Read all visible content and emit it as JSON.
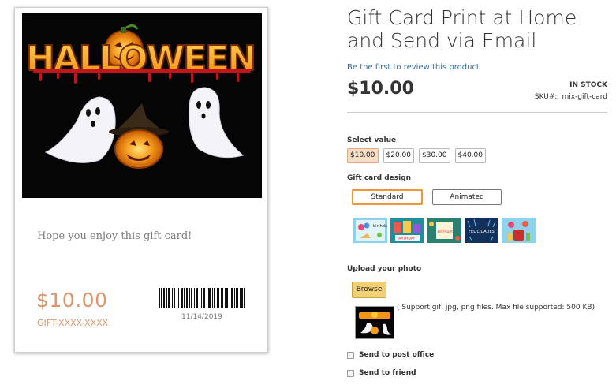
{
  "product": {
    "title": "Gift Card Print at Home and Send via Email",
    "review_link": "Be the first to review this product",
    "price": "$10.00",
    "stock": "IN STOCK",
    "sku_label": "SKU#:",
    "sku_value": "mix-gift-card"
  },
  "card_preview": {
    "art_title": "HALLOWEEN",
    "message": "Hope you enjoy this gift card!",
    "amount": "$10.00",
    "code": "GIFT-XXXX-XXXX",
    "date": "11/14/2019"
  },
  "options": {
    "select_value_label": "Select value",
    "values": [
      "$10.00",
      "$20.00",
      "$30.00",
      "$40.00"
    ],
    "selected_value": "$10.00",
    "design_label": "Gift card design",
    "designs": [
      "Standard",
      "Animated"
    ],
    "selected_design": "Standard",
    "thumbnails": [
      {
        "name": "birthday-balloons-thumbnail",
        "text": "birthday"
      },
      {
        "name": "happy-birthday-thumbnail",
        "text": "BIRTHDAY"
      },
      {
        "name": "birthday-card-thumbnail",
        "text": "BIRTHDAY"
      },
      {
        "name": "felicidades-thumbnail",
        "text": "FELICIDADES"
      },
      {
        "name": "party-thumbnail",
        "text": ""
      }
    ]
  },
  "upload": {
    "label": "Upload your photo",
    "browse_label": "Browse",
    "note": "( Support gif, jpg, png files. Max file supported: 500 KB)"
  },
  "delivery": {
    "post_office": "Send to post office",
    "friend": "Send to friend"
  },
  "colors": {
    "accent": "#f0963a",
    "amount": "#e0946a",
    "link": "#2f6fa7",
    "browse": "#f1cf73"
  }
}
